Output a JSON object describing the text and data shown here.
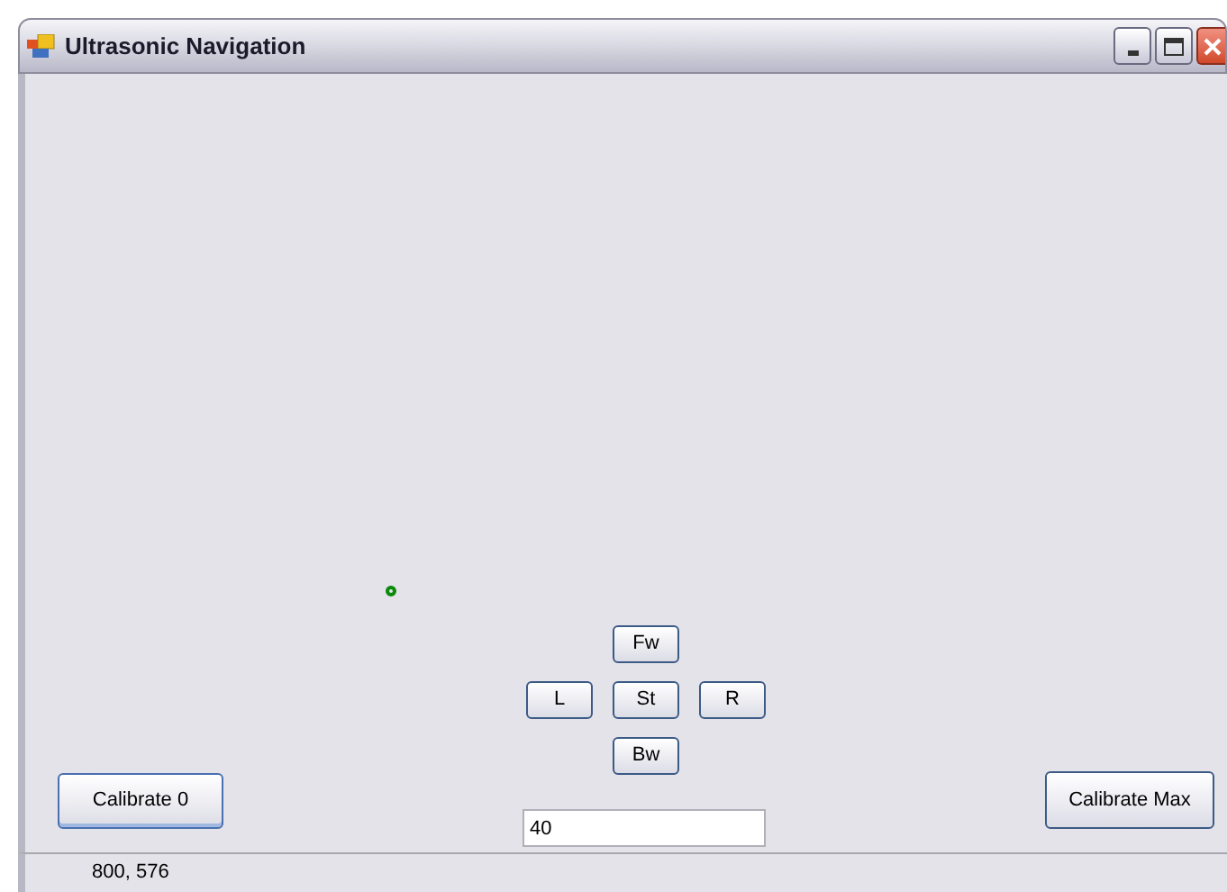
{
  "window": {
    "title": "Ultrasonic Navigation"
  },
  "nav_buttons": {
    "forward": "Fw",
    "left": "L",
    "stop": "St",
    "right": "R",
    "backward": "Bw"
  },
  "calibrate_zero_button": "Calibrate 0",
  "calibrate_max_button": "Calibrate Max",
  "value_field": {
    "value": "40"
  },
  "status_bar": {
    "text": "800, 576"
  }
}
